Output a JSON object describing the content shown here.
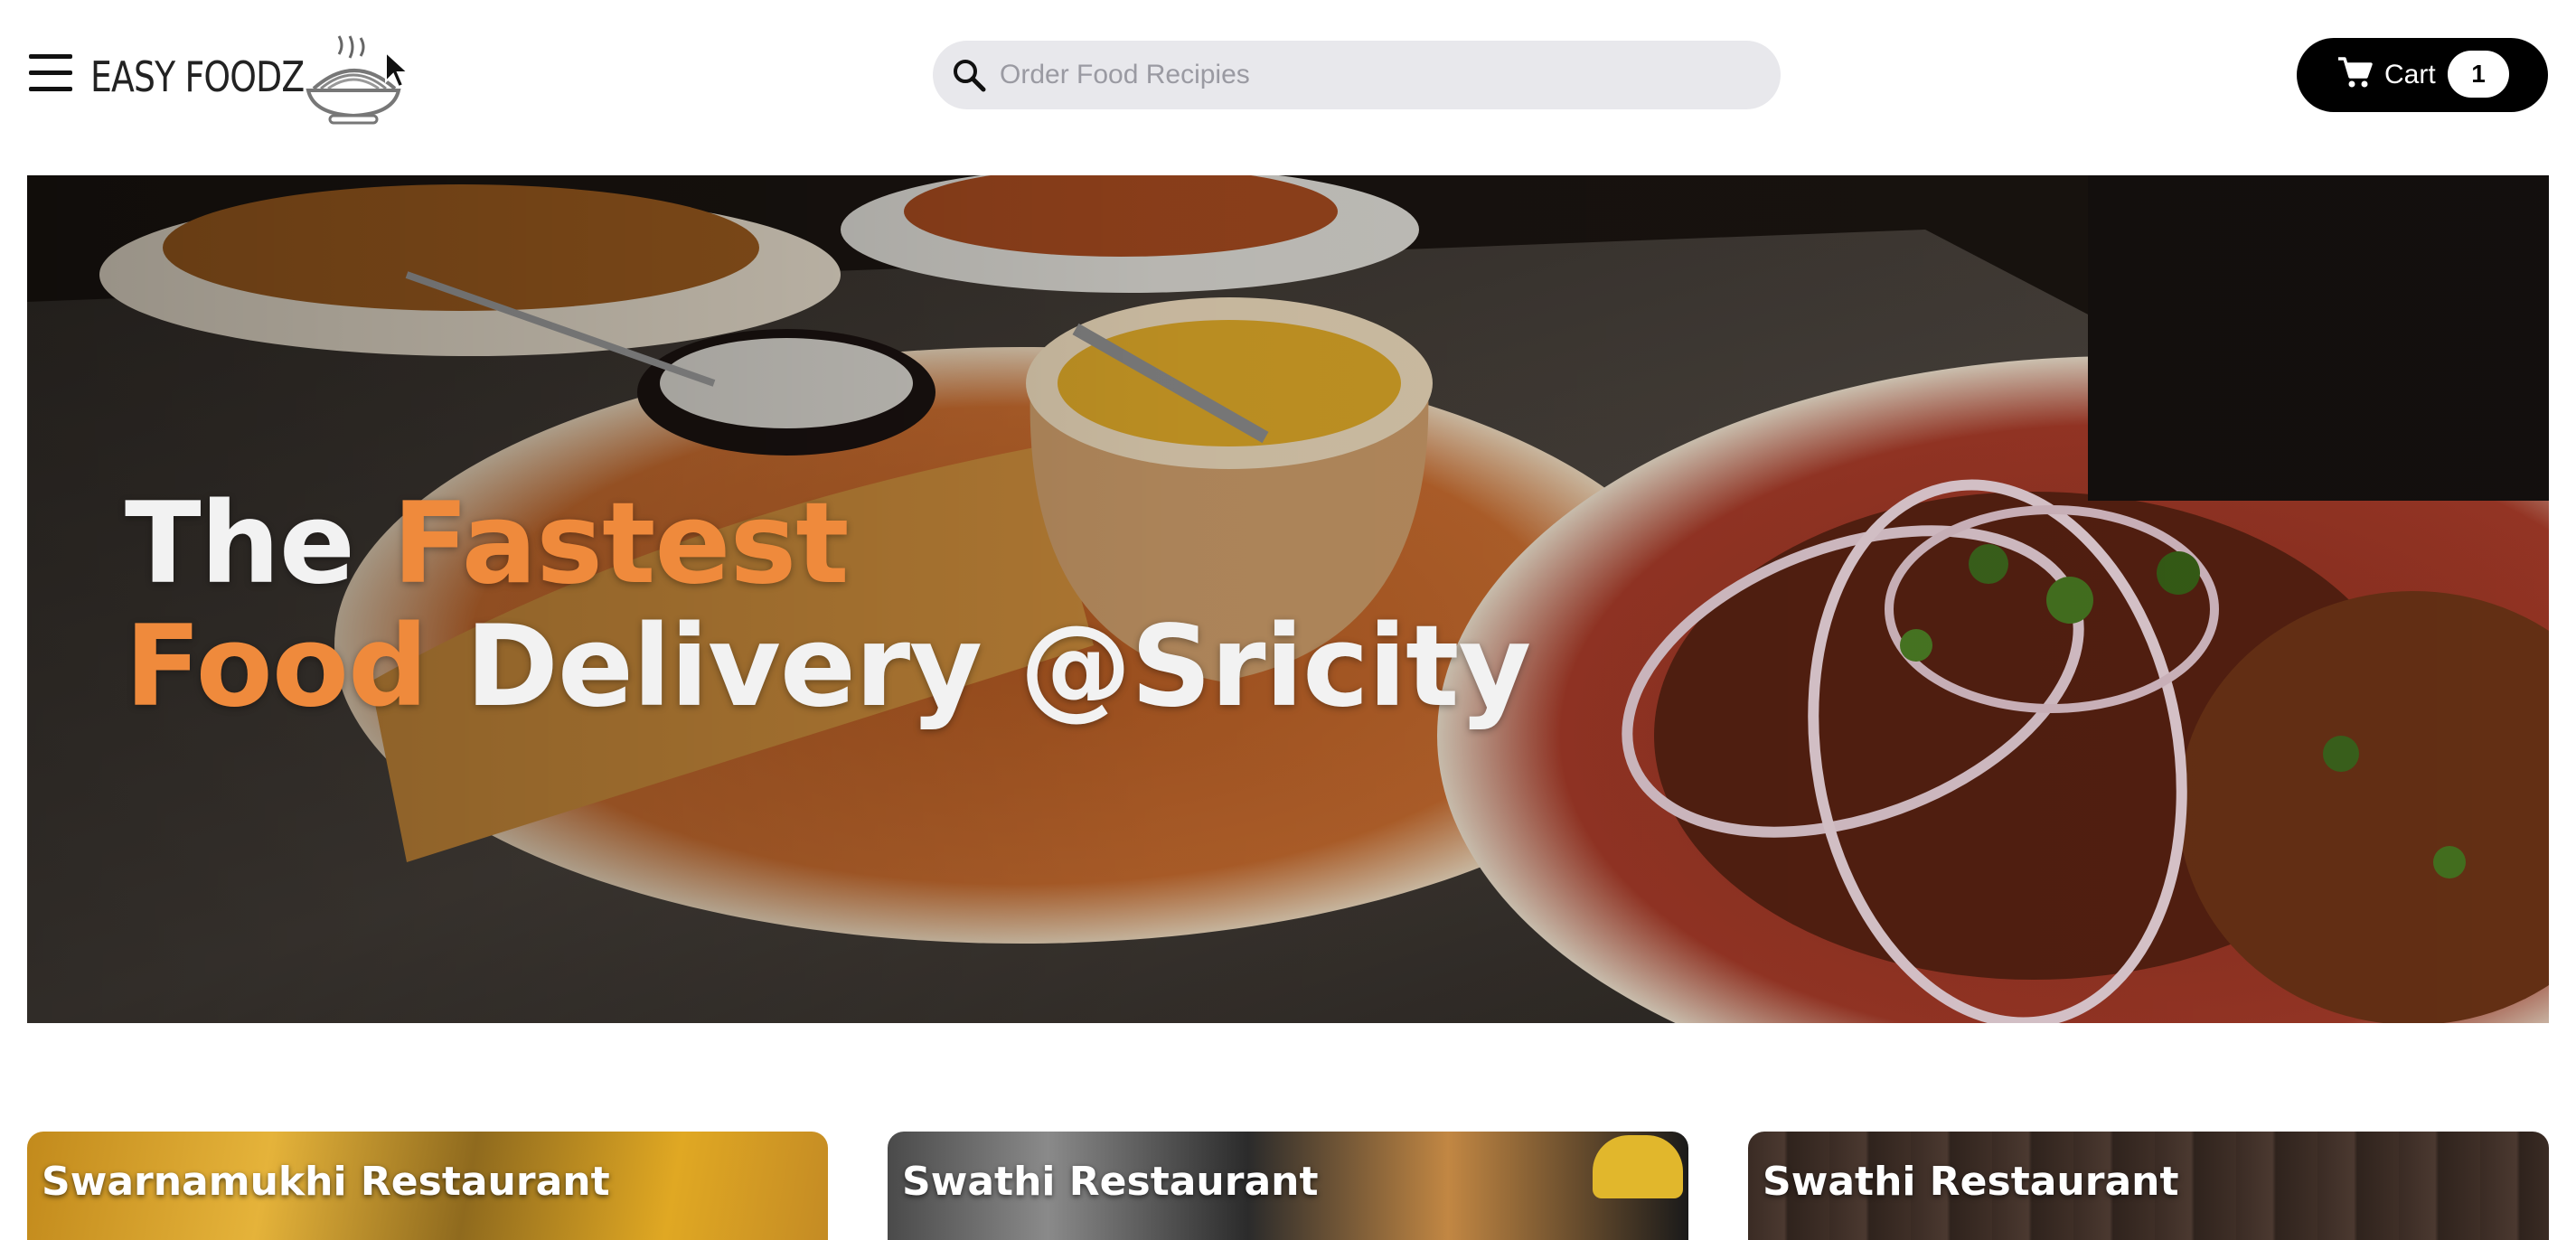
{
  "header": {
    "brand": "EASY FOODZ",
    "search": {
      "placeholder": "Order Food Recipies"
    },
    "cart": {
      "label": "Cart",
      "count": "1"
    }
  },
  "icons": {
    "menu": "hamburger-menu-icon",
    "logo": "noodle-bowl-logo",
    "search": "search-icon",
    "cart": "cart-icon",
    "cursor": "mouse-pointer"
  },
  "hero": {
    "line1_white": "The ",
    "line1_orange": "Fastest",
    "line2_orange": "Food",
    "line2_white": " Delivery @Sricity"
  },
  "restaurants": [
    {
      "name": "Swarnamukhi Restaurant"
    },
    {
      "name": "Swathi Restaurant"
    },
    {
      "name": "Swathi Restaurant"
    }
  ],
  "colors": {
    "accent": "#ef8a3c",
    "cart_bg": "#000000",
    "search_bg": "#e8e8ec"
  }
}
